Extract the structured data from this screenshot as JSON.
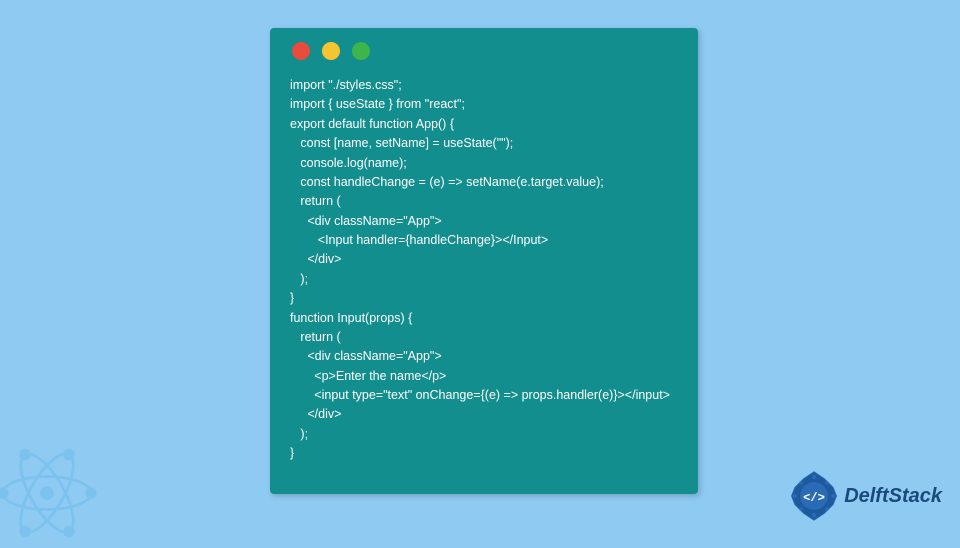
{
  "code": {
    "lines": [
      "import \"./styles.css\";",
      "import { useState } from \"react\";",
      "export default function App() {",
      "   const [name, setName] = useState(\"\");",
      "   console.log(name);",
      "   const handleChange = (e) => setName(e.target.value);",
      "   return (",
      "     <div className=\"App\">",
      "        <Input handler={handleChange}></Input>",
      "     </div>",
      "   );",
      "}",
      "function Input(props) {",
      "   return (",
      "     <div className=\"App\">",
      "       <p>Enter the name</p>",
      "       <input type=\"text\" onChange={(e) => props.handler(e)}></input>",
      "     </div>",
      "   );",
      "}"
    ]
  },
  "traffic_lights": {
    "red": "#e94b3c",
    "yellow": "#f5c431",
    "green": "#3db54a"
  },
  "branding": {
    "name": "DelftStack"
  },
  "colors": {
    "background": "#8fcaf2",
    "window": "#138e8e",
    "code_text": "#ffffff",
    "brand_text": "#1a4a7a"
  }
}
